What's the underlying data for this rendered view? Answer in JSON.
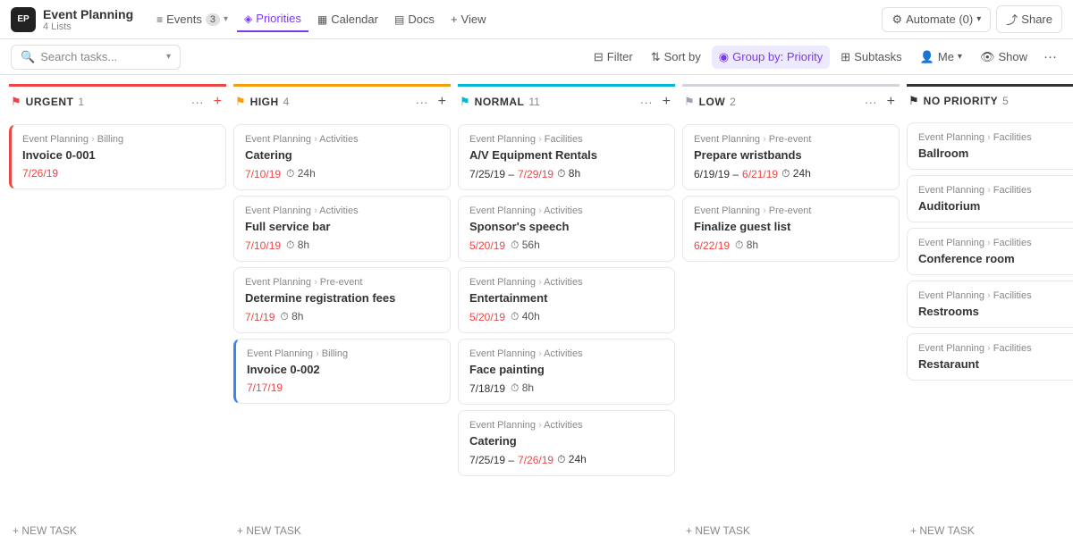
{
  "app": {
    "icon": "EP",
    "title": "Event Planning",
    "subtitle": "4 Lists"
  },
  "nav": {
    "items": [
      {
        "label": "Events",
        "badge": "3",
        "active": false,
        "icon": "≡"
      },
      {
        "label": "Priorities",
        "active": true,
        "icon": "◈"
      },
      {
        "label": "Calendar",
        "active": false,
        "icon": "▦"
      },
      {
        "label": "Docs",
        "active": false,
        "icon": "▤"
      }
    ],
    "view_label": "+ View",
    "automate_label": "Automate (0)",
    "share_label": "Share"
  },
  "toolbar": {
    "search_placeholder": "Search tasks...",
    "filter_label": "Filter",
    "sortby_label": "Sort by",
    "groupby_label": "Group by: Priority",
    "subtasks_label": "Subtasks",
    "me_label": "Me",
    "show_label": "Show"
  },
  "columns": [
    {
      "id": "urgent",
      "title": "URGENT",
      "count": "1",
      "border_class": "column-border-urgent",
      "flag_class": "col-flag-urgent",
      "cards": [
        {
          "breadcrumb_left": "Event Planning",
          "breadcrumb_right": "Billing",
          "title": "Invoice 0-001",
          "date": "7/26/19",
          "date_color": "red",
          "left_bar": "card-left-bar-red"
        }
      ],
      "new_task": "+ NEW TASK"
    },
    {
      "id": "high",
      "title": "HIGH",
      "count": "4",
      "border_class": "column-border-high",
      "flag_class": "col-flag-high",
      "cards": [
        {
          "breadcrumb_left": "Event Planning",
          "breadcrumb_right": "Activities",
          "title": "Catering",
          "date": "7/10/19",
          "clock": "24h",
          "date_color": "red"
        },
        {
          "breadcrumb_left": "Event Planning",
          "breadcrumb_right": "Activities",
          "title": "Full service bar",
          "date": "7/10/19",
          "clock": "8h",
          "date_color": "red"
        },
        {
          "breadcrumb_left": "Event Planning",
          "breadcrumb_right": "Pre-event",
          "title": "Determine registration fees",
          "date": "7/1/19",
          "clock": "8h",
          "date_color": "red"
        },
        {
          "breadcrumb_left": "Event Planning",
          "breadcrumb_right": "Billing",
          "title": "Invoice 0-002",
          "date": "7/17/19",
          "date_color": "red",
          "left_bar": "card-left-bar-blue"
        }
      ],
      "new_task": "+ NEW TASK"
    },
    {
      "id": "normal",
      "title": "NORMAL",
      "count": "11",
      "border_class": "column-border-normal",
      "flag_class": "col-flag-normal",
      "cards": [
        {
          "breadcrumb_left": "Event Planning",
          "breadcrumb_right": "Facilities",
          "title": "A/V Equipment Rentals",
          "date_range_start": "7/25/19",
          "date_range_end": "7/29/19",
          "date_range_end_color": "red",
          "clock": "8h"
        },
        {
          "breadcrumb_left": "Event Planning",
          "breadcrumb_right": "Activities",
          "title": "Sponsor's speech",
          "date": "5/20/19",
          "clock": "56h",
          "date_color": "red"
        },
        {
          "breadcrumb_left": "Event Planning",
          "breadcrumb_right": "Activities",
          "title": "Entertainment",
          "date": "5/20/19",
          "clock": "40h",
          "date_color": "red"
        },
        {
          "breadcrumb_left": "Event Planning",
          "breadcrumb_right": "Activities",
          "title": "Face painting",
          "date": "7/18/19",
          "clock": "8h",
          "date_color": "normal"
        },
        {
          "breadcrumb_left": "Event Planning",
          "breadcrumb_right": "Activities",
          "title": "Catering",
          "date_range_start": "7/25/19",
          "date_range_end": "7/26/19",
          "date_range_end_color": "red",
          "clock": "24h"
        }
      ],
      "new_task": "+ NEW TASK"
    },
    {
      "id": "low",
      "title": "LOW",
      "count": "2",
      "border_class": "column-border-low",
      "flag_class": "col-flag-low",
      "cards": [
        {
          "breadcrumb_left": "Event Planning",
          "breadcrumb_right": "Pre-event",
          "title": "Prepare wristbands",
          "date_range_start": "6/19/19",
          "date_range_end": "6/21/19",
          "date_range_end_color": "red",
          "clock": "24h"
        },
        {
          "breadcrumb_left": "Event Planning",
          "breadcrumb_right": "Pre-event",
          "title": "Finalize guest list",
          "date": "6/22/19",
          "clock": "8h",
          "date_color": "red"
        }
      ],
      "new_task": "+ NEW TASK"
    },
    {
      "id": "nopriority",
      "title": "NO PRIORITY",
      "count": "5",
      "border_class": "column-border-nopriority",
      "flag_class": "col-flag-nopriority",
      "cards": [
        {
          "breadcrumb_left": "Event Planning",
          "breadcrumb_right": "Facilities",
          "title": "Ballroom"
        },
        {
          "breadcrumb_left": "Event Planning",
          "breadcrumb_right": "Facilities",
          "title": "Auditorium"
        },
        {
          "breadcrumb_left": "Event Planning",
          "breadcrumb_right": "Facilities",
          "title": "Conference room"
        },
        {
          "breadcrumb_left": "Event Planning",
          "breadcrumb_right": "Facilities",
          "title": "Restrooms"
        },
        {
          "breadcrumb_left": "Event Planning",
          "breadcrumb_right": "Facilities",
          "title": "Restaraunt"
        }
      ],
      "new_task": "+ NEW TASK"
    }
  ]
}
